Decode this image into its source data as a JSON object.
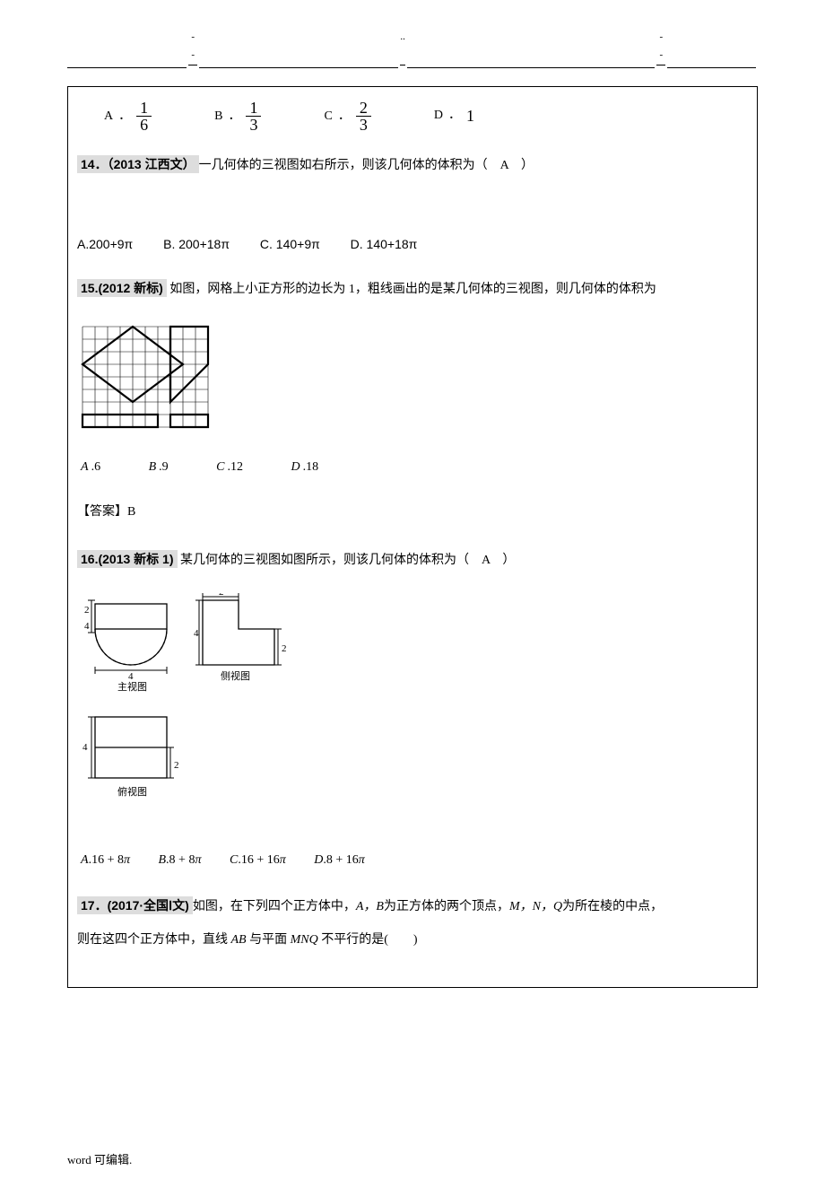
{
  "header": {
    "dash1": "- -",
    "dot1": "..",
    "dash2": "- -"
  },
  "q13_options": {
    "A": {
      "label": "A",
      "num": "1",
      "den": "6"
    },
    "B": {
      "label": "B",
      "num": "1",
      "den": "3"
    },
    "C": {
      "label": "C",
      "num": "2",
      "den": "3"
    },
    "D": {
      "label": "D",
      "val": "1"
    }
  },
  "q14": {
    "tag": "14．（2013 江西文）",
    "text": "一几何体的三视图如右所示，则该几何体的体积为（",
    "ans": "A",
    "close": "）",
    "options": {
      "A": "A.200+9π",
      "B": "B. 200+18π",
      "C": "C. 140+9π",
      "D": "D. 140+18π"
    }
  },
  "q15": {
    "tag": "15.(2012 新标)",
    "text": "如图，网格上小正方形的边长为 1，粗线画出的是某几何体的三视图，则几何体的体积为",
    "options": {
      "A": {
        "lab": "A",
        "val": ".6"
      },
      "B": {
        "lab": "B",
        "val": ".9"
      },
      "C": {
        "lab": "C",
        "val": ".12"
      },
      "D": {
        "lab": "D",
        "val": ".18"
      }
    },
    "answer_label": "【答案】",
    "answer": "B"
  },
  "q16": {
    "tag": "16.(2013 新标 1)",
    "text": "某几何体的三视图如图所示，则该几何体的体积为（",
    "ans": "A",
    "close": "）",
    "view_labels": {
      "front": "主视图",
      "side": "侧视图",
      "top": "俯视图"
    },
    "dims": {
      "d2": "2",
      "d4": "4"
    },
    "options": {
      "A": {
        "lab": "A",
        "val": ".16 + 8π"
      },
      "B": {
        "lab": "B",
        "val": ".8 + 8π"
      },
      "C": {
        "lab": "C",
        "val": ".16 + 16π"
      },
      "D": {
        "lab": "D",
        "val": ".8 + 16π"
      }
    }
  },
  "q17": {
    "tag": "17．(2017·全国Ⅰ文)",
    "text1": "如图，在下列四个正方体中，",
    "AB1": "A，B",
    "text2": "为正方体的两个顶点，",
    "MNQ": "M，N，Q",
    "text3": "为所在棱的中点，",
    "text4": "则在这四个正方体中，直线 ",
    "AB2": "AB",
    "text5": " 与平面 ",
    "MNQ2": "MNQ",
    "text6": " 不平行的是(　　)"
  },
  "footer": "word  可编辑."
}
